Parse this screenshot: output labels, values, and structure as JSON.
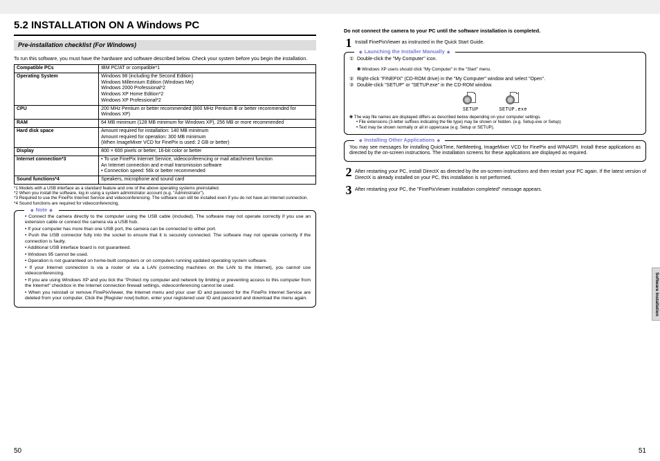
{
  "left": {
    "title": "5.2 INSTALLATION ON A Windows PC",
    "subhead": "Pre-installation checklist (For Windows)",
    "intro": "To run this software, you must have the hardware and software described below. Check your system before you begin the installation.",
    "spec_rows": [
      {
        "h": "Compatible PCs",
        "v": "IBM PC/AT or compatible*1"
      },
      {
        "h": "Operating System",
        "v": "Windows 98 (including the Second Edition)\nWindows Millennium Edition (Windows Me)\nWindows 2000 Professional*2\nWindows XP Home Edition*2\nWindows XP Professional*2"
      },
      {
        "h": "CPU",
        "v": "200 MHz Pentium or better recommended (800 MHz Pentium Ⅲ or better recommended for Windows XP)"
      },
      {
        "h": "RAM",
        "v": "64 MB minimum (128 MB minimum for Windows XP), 256 MB or more recommended"
      },
      {
        "h": "Hard disk space",
        "v": "Amount required for installation: 140 MB minimum\nAmount required for operation: 300 MB minimum\n(When ImageMixer VCD for FinePix is used: 2 GB or better)"
      },
      {
        "h": "Display",
        "v": "800 × 600 pixels or better, 16-bit color or better"
      },
      {
        "h": "Internet connection*3",
        "v": "• To use FinePix Internet Service, videoconferencing or mail attachment function\n  An Internet connection and e-mail transmission software\n• Connection speed: 56k or better recommended"
      },
      {
        "h": "Sound functions*4",
        "v": "Speakers, microphone and sound card"
      }
    ],
    "footnotes": [
      "*1 Models with a USB interface as a standard feature and one of the above operating systems preinstalled.",
      "*2 When you install the software, log in using a system administrator account (e.g. \"Administrator\").",
      "*3 Required to use the FinePix Internet Service and videoconferencing. The software can still be installed even if you do not have an Internet connection.",
      "*4 Sound functions are required for videoconferencing."
    ],
    "note_label": "Note",
    "notes": [
      "Connect the camera directly to the computer using the USB cable (included). The software may not operate correctly if you use an extension cable or connect the camera via a USB hub.",
      "If your computer has more than one USB port, the camera can be connected to either port.",
      "Push the USB connector fully into the socket to ensure that it is securely connected. The software may not operate correctly if the connection is faulty.",
      "Additional USB interface board is not guaranteed.",
      "Windows 95 cannot be used.",
      "Operation is not guaranteed on home-built computers or on computers running updated operating system software.",
      "If your Internet connection is via a router or via a LAN (connecting machines on the LAN to the Internet), you cannot use videoconferencing.",
      "If you are using Windows XP and you tick the \"Protect my computer and network by limiting or preventing access to this computer from the Internet\" checkbox in the Internet connection firewall settings, videoconferencing cannot be used.",
      "When you reinstall or remove FinePixViewer, the Internet menu and your user ID and password for the FinePix Internet Service are deleted from your computer. Click the [Register now] button, enter your registered user ID and password and download the menu again."
    ],
    "page_num": "50"
  },
  "right": {
    "warning": "Do not connect the camera to your PC until the software installation is completed.",
    "step1": "Install FinePixViewer as instructed in the Quick Start Guide.",
    "launch_label": "Launching the Installer Manually",
    "launch_steps": [
      "Double-click the \"My Computer\" icon.",
      "Right-click \"FINEPIX\" (CD-ROM drive) in the \"My Computer\" window and select \"Open\".",
      "Double-click \"SETUP\" or \"SETUP.exe\" in the CD-ROM window."
    ],
    "launch_star": "Windows XP users should click \"My Computer\" in the \"Start\" menu.",
    "setup_a": "SETUP",
    "setup_b": "SETUP.exe",
    "tiny_notes_lead": "✽ The way file names are displayed differs as described below depending on your computer settings.",
    "tiny_notes": [
      "File extensions (3-letter suffixes indicating the file type) may be shown or hidden. (e.g. Setup.exe or Setup)",
      "Text may be shown normally or all in uppercase (e.g. Setup or SETUP)."
    ],
    "other_label": "Installing Other Applications",
    "other_body": "You may see messages for installing QuickTime, NetMeeting, ImageMixer VCD for FinePix and WINASPI. Install these applications as directed by the on-screen instructions. The installation screens for these applications are displayed as required.",
    "step2": "After restarting your PC, install DirectX as directed by the on-screen instructions and then restart your PC again. If the latest version of DirectX is already installed on your PC, this installation is not performed.",
    "step3": "After restarting your PC, the \"FinePixViewer installation completed\" message appears.",
    "side_tab": "Software Installation",
    "page_num": "51",
    "circ": [
      "①",
      "②",
      "③"
    ]
  }
}
